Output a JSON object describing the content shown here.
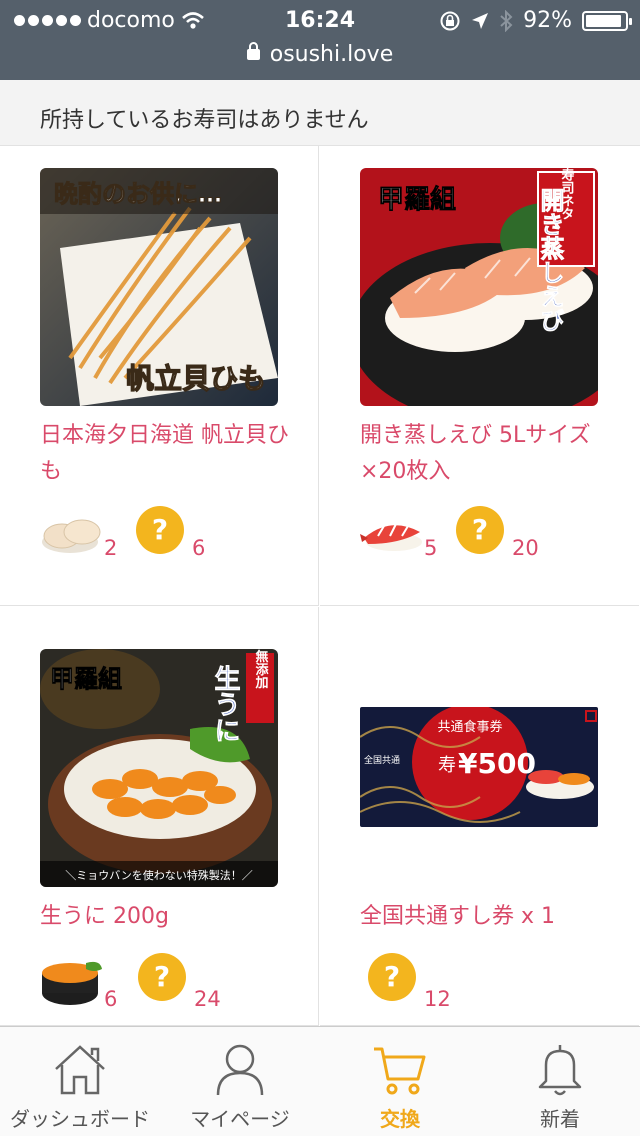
{
  "status_bar": {
    "carrier": "docomo",
    "time": "16:24",
    "battery": "92%",
    "battery_level": 0.92
  },
  "browser": {
    "url": "osushi.love"
  },
  "notice": "所持しているお寿司はありません",
  "products": [
    {
      "title": "日本海夕日海道 帆立貝ひも",
      "image_caption_top": "晩酌のお供に…",
      "image_caption_bottom": "帆立貝ひも",
      "sushi_icon": "scallop-sushi-icon",
      "sushi_count": "2",
      "unknown_count": "6"
    },
    {
      "title": "開き蒸しえび 5Lサイズ×20枚入",
      "image_brand": "甲羅組",
      "image_badge": "寿司ネタ",
      "image_caption": "開き蒸しえび",
      "sushi_icon": "shrimp-sushi-icon",
      "sushi_count": "5",
      "unknown_count": "20"
    },
    {
      "title": "生うに 200g",
      "image_brand": "甲羅組",
      "image_badge": "無添加",
      "image_caption": "生うに",
      "image_footer": "＼ミョウバンを使わない特殊製法！／",
      "sushi_icon": "uni-gunkan-icon",
      "sushi_count": "6",
      "unknown_count": "24"
    },
    {
      "title": "全国共通すし券 x 1",
      "image_title": "共通食事券",
      "image_price": "¥500",
      "image_label": "全国共通",
      "image_kanji": "寿",
      "unknown_count": "12"
    }
  ],
  "question_mark": "?",
  "tabs": [
    {
      "label": "ダッシュボード",
      "icon": "home-icon"
    },
    {
      "label": "マイページ",
      "icon": "person-icon"
    },
    {
      "label": "交換",
      "icon": "cart-icon",
      "active": true
    },
    {
      "label": "新着",
      "icon": "bell-icon"
    }
  ],
  "colors": {
    "accent": "#f0a81a",
    "title_pink": "#d94a6a",
    "question_badge": "#f3b51e",
    "status_bar": "#55606b"
  }
}
